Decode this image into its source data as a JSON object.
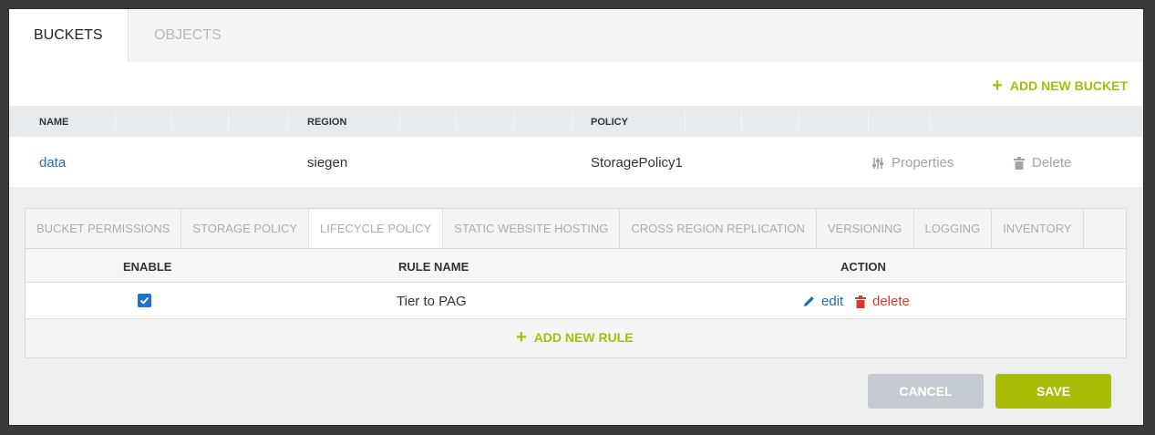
{
  "tabs": {
    "buckets": "BUCKETS",
    "objects": "OBJECTS"
  },
  "toolbar": {
    "add_bucket": "ADD NEW BUCKET"
  },
  "bucket_table": {
    "headers": {
      "name": "NAME",
      "region": "REGION",
      "policy": "POLICY"
    },
    "row": {
      "name": "data",
      "region": "siegen",
      "policy": "StoragePolicy1",
      "properties": "Properties",
      "delete": "Delete"
    }
  },
  "sub_tabs": [
    "BUCKET PERMISSIONS",
    "STORAGE POLICY",
    "LIFECYCLE POLICY",
    "STATIC WEBSITE HOSTING",
    "CROSS REGION REPLICATION",
    "VERSIONING",
    "LOGGING",
    "INVENTORY"
  ],
  "active_sub_tab": "LIFECYCLE POLICY",
  "rules_table": {
    "headers": {
      "enable": "ENABLE",
      "rule_name": "RULE NAME",
      "action": "ACTION"
    },
    "rows": [
      {
        "enabled": true,
        "name": "Tier to PAG",
        "edit": "edit",
        "delete": "delete"
      }
    ],
    "add_rule": "ADD NEW RULE"
  },
  "buttons": {
    "cancel": "CANCEL",
    "save": "SAVE"
  },
  "colors": {
    "accent": "#a9bd08",
    "link": "#2a6db0",
    "danger": "#e0372b",
    "checkbox": "#1e73d2"
  }
}
